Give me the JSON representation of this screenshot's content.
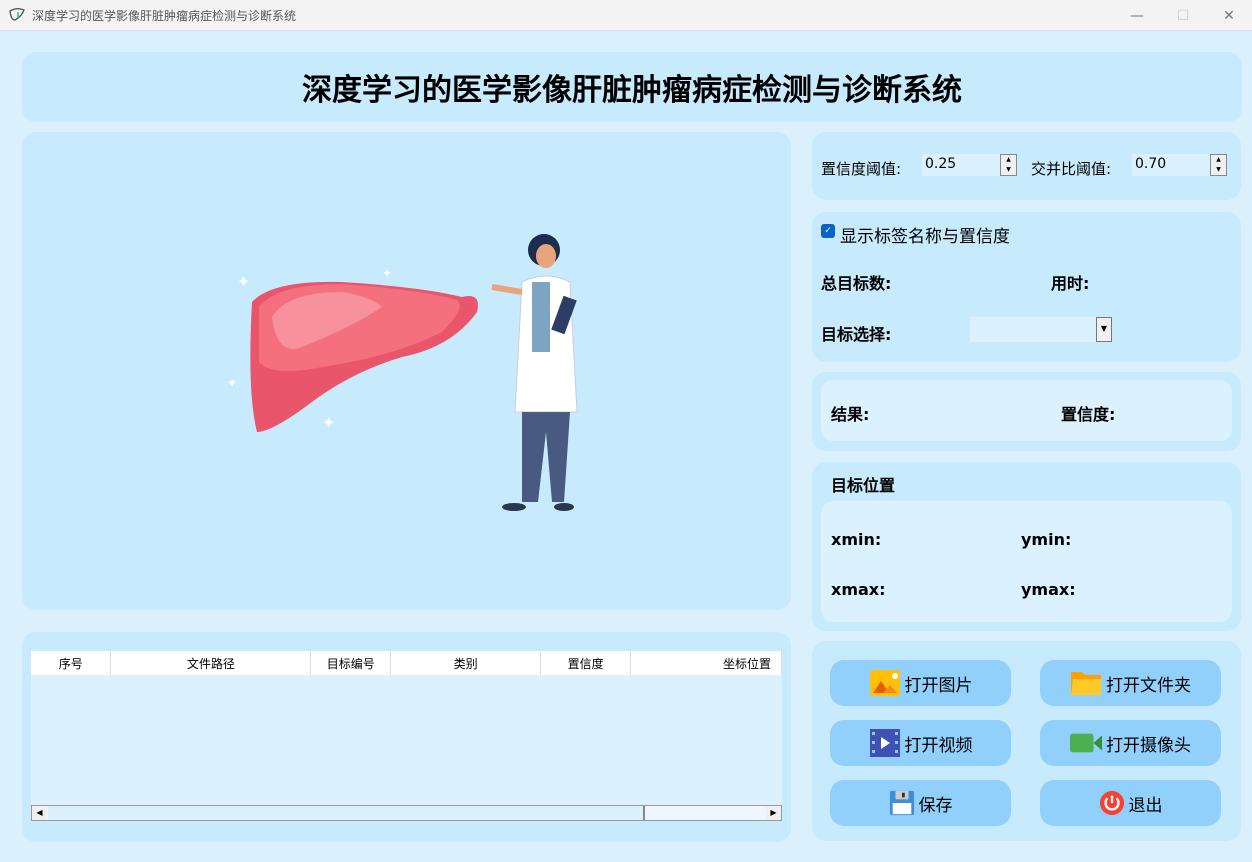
{
  "window": {
    "title": "深度学习的医学影像肝脏肿瘤病症检测与诊断系统",
    "minimize": "—",
    "maximize": "☐",
    "close": "✕"
  },
  "header": {
    "title": "深度学习的医学影像肝脏肿瘤病症检测与诊断系统"
  },
  "settings": {
    "conf_label": "置信度阈值:",
    "conf_value": "0.25",
    "iou_label": "交并比阈值:",
    "iou_value": "0.70"
  },
  "stats": {
    "show_label": "显示标签名称与置信度",
    "show_checked": true,
    "total_label": "总目标数:",
    "time_label": "用时:",
    "select_label": "目标选择:",
    "select_value": ""
  },
  "result": {
    "result_label": "结果:",
    "conf_label": "置信度:"
  },
  "position": {
    "title": "目标位置",
    "xmin": "xmin:",
    "ymin": "ymin:",
    "xmax": "xmax:",
    "ymax": "ymax:"
  },
  "table": {
    "columns": [
      "序号",
      "文件路径",
      "目标编号",
      "类别",
      "置信度",
      "坐标位置"
    ],
    "rows": []
  },
  "buttons": {
    "open_image": "打开图片",
    "open_folder": "打开文件夹",
    "open_video": "打开视频",
    "open_camera": "打开摄像头",
    "save": "保存",
    "exit": "退出"
  }
}
